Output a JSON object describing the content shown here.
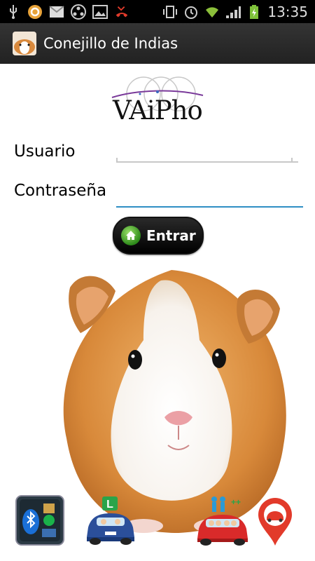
{
  "status_bar": {
    "time": "13:35",
    "left_icons": [
      "usb-icon",
      "sync-icon",
      "gmail-icon",
      "sms-icon",
      "image-icon",
      "missed-call-icon"
    ],
    "right_icons": [
      "vibrate-icon",
      "alarm-icon",
      "wifi-icon",
      "signal-icon",
      "battery-icon"
    ]
  },
  "app_bar": {
    "title": "Conejillo de Indias",
    "icon": "guinea-pig-app-icon"
  },
  "logo": {
    "text": "VAiPho"
  },
  "form": {
    "user_label": "Usuario",
    "user_value": "",
    "password_label": "Contraseña",
    "password_value": ""
  },
  "enter_button": {
    "label": "Entrar",
    "icon": "home-icon"
  },
  "bottom_icons": [
    "bluetooth-apps-icon",
    "learner-car-icon",
    "carpool-group-icon",
    "location-car-pin-icon"
  ],
  "colors": {
    "status_bar_bg": "#000000",
    "app_bar_bg": "#2b2b2b",
    "active_field_underline": "#2f8fc4",
    "button_bg": "#000000"
  }
}
